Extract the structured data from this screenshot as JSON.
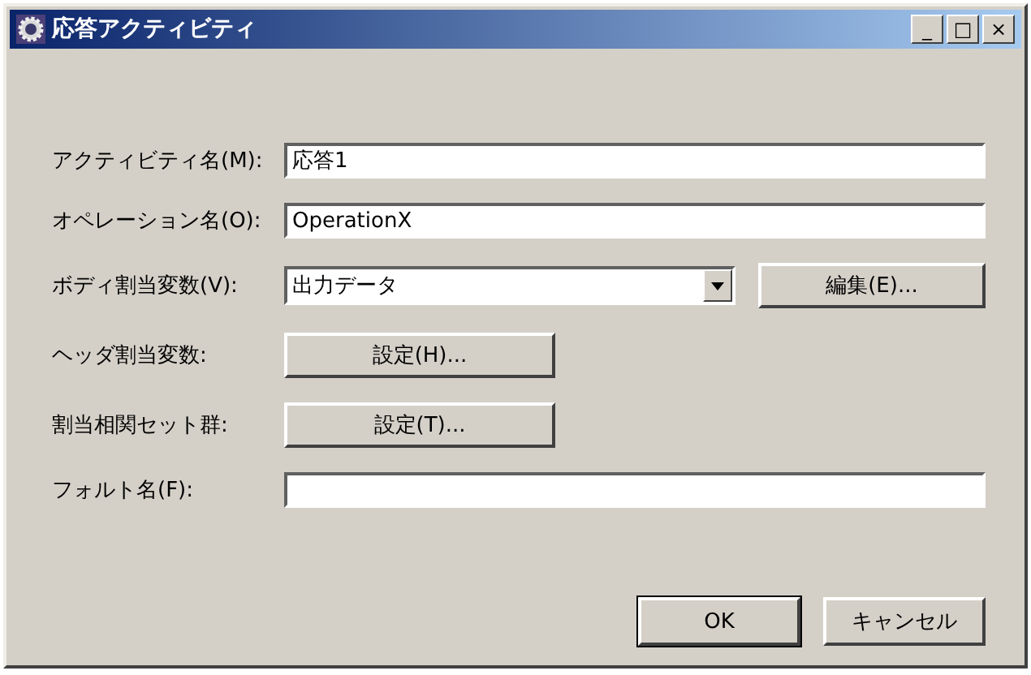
{
  "window": {
    "title": "応答アクティビティ",
    "controls": [
      "_",
      "□",
      "×"
    ]
  },
  "rows": [
    {
      "kind": "text",
      "label": "アクティビティ名(M):",
      "value": "応答1"
    },
    {
      "kind": "text",
      "label": "オペレーション名(O):",
      "value": "OperationX"
    },
    {
      "kind": "combo",
      "label": "ボディ割当変数(V):",
      "value": "出力データ",
      "button": "編集(E)..."
    },
    {
      "kind": "button",
      "label": "ヘッダ割当変数:",
      "button": "設定(H)..."
    },
    {
      "kind": "button",
      "label": "割当相関セット群:",
      "button": "設定(T)..."
    },
    {
      "kind": "text",
      "label": "フォルト名(F):",
      "value": ""
    }
  ],
  "buttons": [
    {
      "label": "OK",
      "default": true
    },
    {
      "label": "キャンセル",
      "default": false
    }
  ]
}
